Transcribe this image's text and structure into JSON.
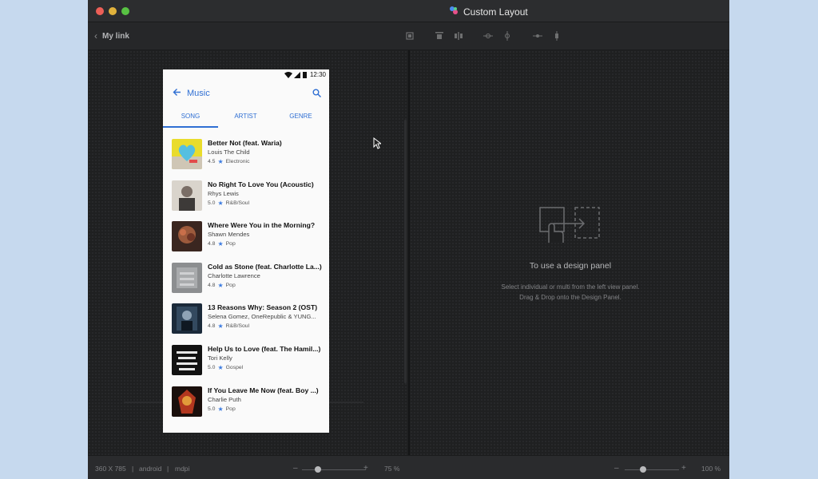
{
  "window": {
    "title": "Custom Layout"
  },
  "toolbar": {
    "back_label": "My link"
  },
  "phone": {
    "time": "12:30",
    "appbar_title": "Music",
    "tabs": [
      {
        "label": "SONG"
      },
      {
        "label": "ARTIST"
      },
      {
        "label": "GENRE"
      }
    ],
    "songs": [
      {
        "title": "Better Not (feat. Waria)",
        "artist": "Louis The Child",
        "rating": "4.5",
        "genre": "Electronic"
      },
      {
        "title": "No Right To Love You (Acoustic)",
        "artist": "Rhys Lewis",
        "rating": "5.0",
        "genre": "R&B/Soul"
      },
      {
        "title": "Where Were You in the Morning?",
        "artist": "Shawn Mendes",
        "rating": "4.8",
        "genre": "Pop"
      },
      {
        "title": "Cold as Stone (feat. Charlotte La...)",
        "artist": "Charlotte Lawrence",
        "rating": "4.8",
        "genre": "Pop"
      },
      {
        "title": "13 Reasons Why: Season 2 (OST)",
        "artist": "Selena Gomez, OneRepublic & YUNG...",
        "rating": "4.8",
        "genre": "R&B/Soul"
      },
      {
        "title": "Help Us to Love (feat. The Hamil...)",
        "artist": "Tori Kelly",
        "rating": "5.0",
        "genre": "Gospel"
      },
      {
        "title": "If You Leave Me Now (feat. Boy ...)",
        "artist": "Charlie Puth",
        "rating": "5.0",
        "genre": "Pop"
      }
    ]
  },
  "design_panel": {
    "title": "To use a design panel",
    "desc_line1": "Select individual or multi from the left view panel.",
    "desc_line2": "Drag & Drop onto the Design Panel."
  },
  "statusbar": {
    "size": "360 X 785",
    "sep1": "|",
    "platform": "android",
    "sep2": "|",
    "density": "mdpi",
    "left_zoom": "75 %",
    "right_zoom": "100 %",
    "minus": "–",
    "plus": "+"
  },
  "colors": {
    "accent": "#2f6fd3",
    "star": "#3b7be0"
  }
}
